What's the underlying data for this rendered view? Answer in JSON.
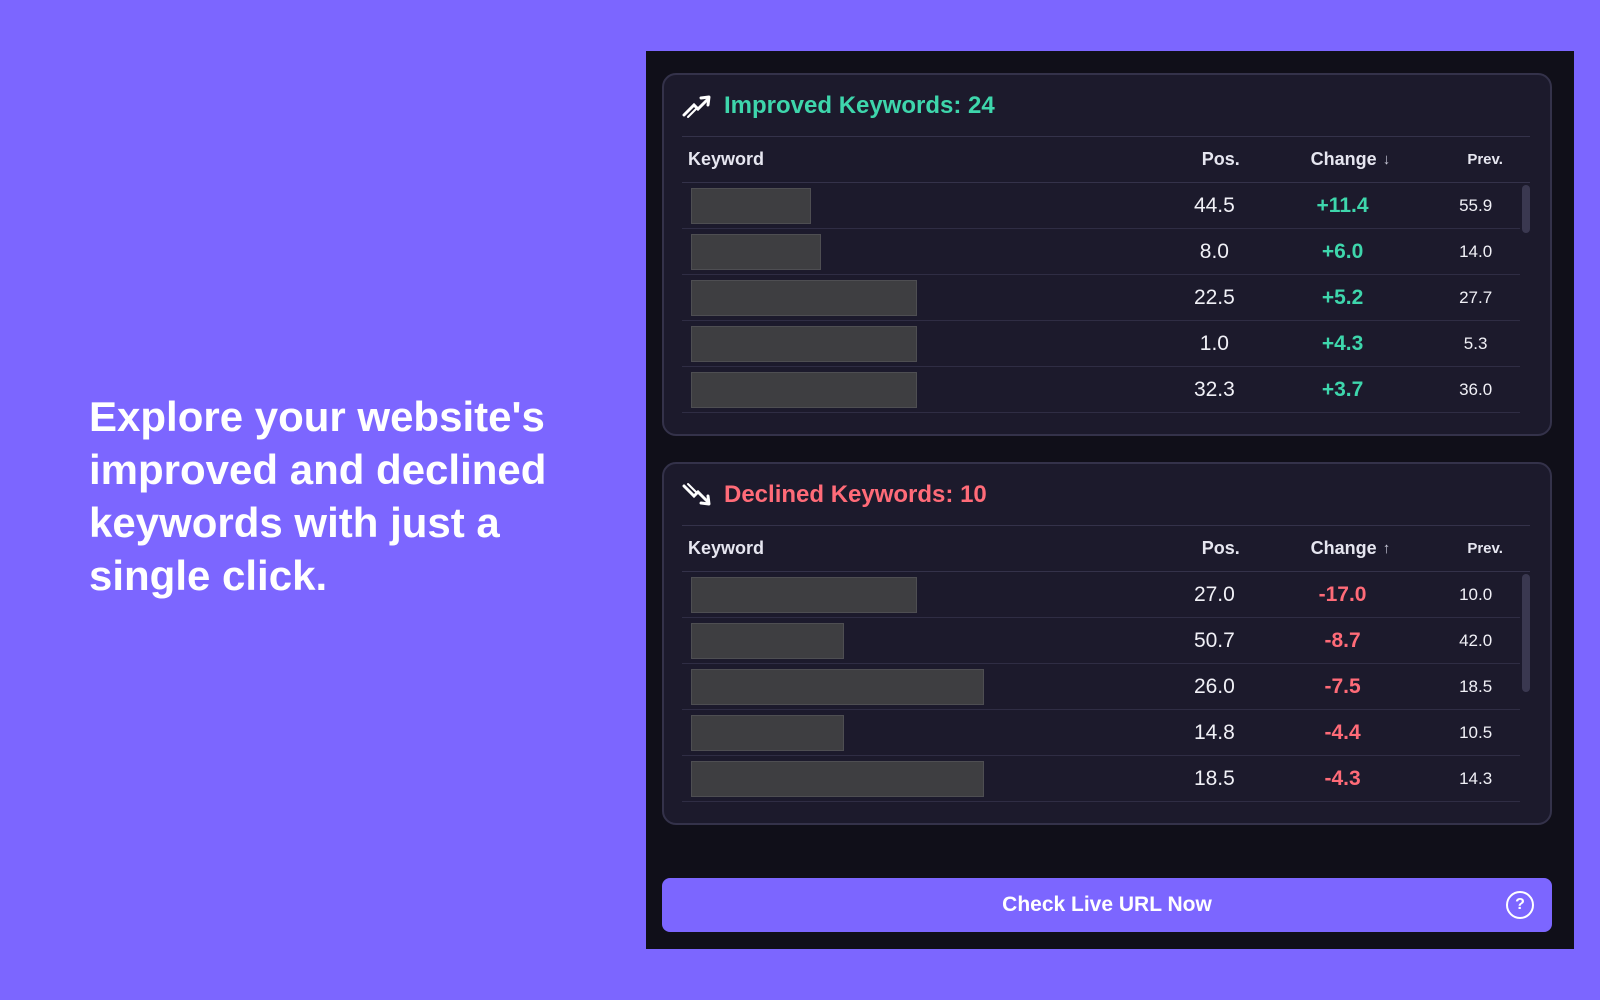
{
  "hero": {
    "text": "Explore your website's improved and declined keywords with just a single click."
  },
  "improved": {
    "title": "Improved Keywords: 24",
    "icon": "trend-up-icon",
    "color": "#3ed6ac",
    "columns": {
      "keyword": "Keyword",
      "pos": "Pos.",
      "change": "Change",
      "prev": "Prev.",
      "sort": "↓"
    },
    "rows": [
      {
        "pos": "44.5",
        "change": "+11.4",
        "prev": "55.9",
        "bar_width": 120
      },
      {
        "pos": "8.0",
        "change": "+6.0",
        "prev": "14.0",
        "bar_width": 130
      },
      {
        "pos": "22.5",
        "change": "+5.2",
        "prev": "27.7",
        "bar_width": 226
      },
      {
        "pos": "1.0",
        "change": "+4.3",
        "prev": "5.3",
        "bar_width": 226
      },
      {
        "pos": "32.3",
        "change": "+3.7",
        "prev": "36.0",
        "bar_width": 226
      }
    ]
  },
  "declined": {
    "title": "Declined Keywords: 10",
    "icon": "trend-down-icon",
    "color": "#ff6b78",
    "columns": {
      "keyword": "Keyword",
      "pos": "Pos.",
      "change": "Change",
      "prev": "Prev.",
      "sort": "↑"
    },
    "rows": [
      {
        "pos": "27.0",
        "change": "-17.0",
        "prev": "10.0",
        "bar_width": 226
      },
      {
        "pos": "50.7",
        "change": "-8.7",
        "prev": "42.0",
        "bar_width": 153
      },
      {
        "pos": "26.0",
        "change": "-7.5",
        "prev": "18.5",
        "bar_width": 293
      },
      {
        "pos": "14.8",
        "change": "-4.4",
        "prev": "10.5",
        "bar_width": 153
      },
      {
        "pos": "18.5",
        "change": "-4.3",
        "prev": "14.3",
        "bar_width": 293
      }
    ]
  },
  "cta": {
    "label": "Check Live URL Now",
    "help": "?"
  }
}
